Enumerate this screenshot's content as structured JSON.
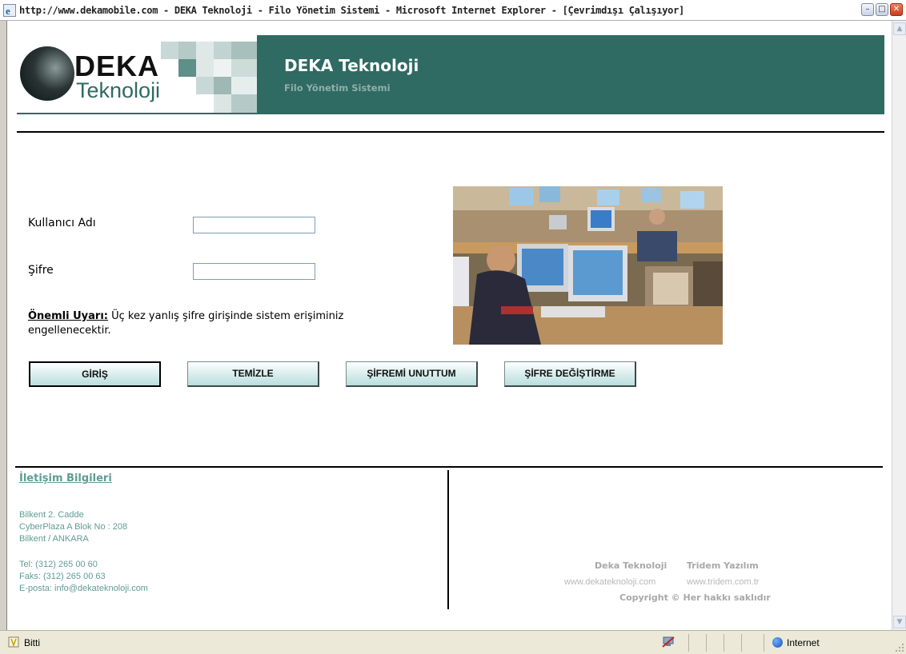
{
  "window": {
    "title": "http://www.dekamobile.com - DEKA Teknoloji - Filo Yönetim Sistemi - Microsoft Internet Explorer - [Çevrimdışı Çalışıyor]"
  },
  "header": {
    "logo_word1": "DEKA",
    "logo_word2": "Teknoloji",
    "title": "DEKA Teknoloji",
    "subtitle": "Filo Yönetim Sistemi",
    "background_color": "#2f6a63"
  },
  "login": {
    "username_label": "Kullanıcı Adı",
    "username_value": "",
    "password_label": "Şifre",
    "password_value": "",
    "warning_title": "Önemli Uyarı:",
    "warning_text": " Üç kez yanlış şifre girişinde sistem erişiminiz engellenecektir."
  },
  "buttons": {
    "login": "GİRİŞ",
    "clear": "TEMİZLE",
    "forgot": "ŞİFREMİ UNUTTUM",
    "change": "ŞİFRE DEĞİŞTİRME"
  },
  "footer": {
    "contact_title": "İletişim Bilgileri",
    "address_line1": "Bilkent 2. Cadde",
    "address_line2": "CyberPlaza A Blok No : 208",
    "address_line3": "Bilkent / ANKARA",
    "phone": "Tel: (312) 265 00 60",
    "fax": "Faks: (312) 265 00 63",
    "email": "E-posta: info@dekateknoloji.com",
    "credit1_name": "Deka Teknoloji",
    "credit1_url": "www.dekateknoloji.com",
    "credit2_name": "Tridem Yazılım",
    "credit2_url": "www.tridem.com.tr",
    "copyright": "Copyright ©  Her hakkı saklıdır",
    "link_color": "#5f9c93"
  },
  "statusbar": {
    "status": "Bitti",
    "zone": "Internet"
  }
}
